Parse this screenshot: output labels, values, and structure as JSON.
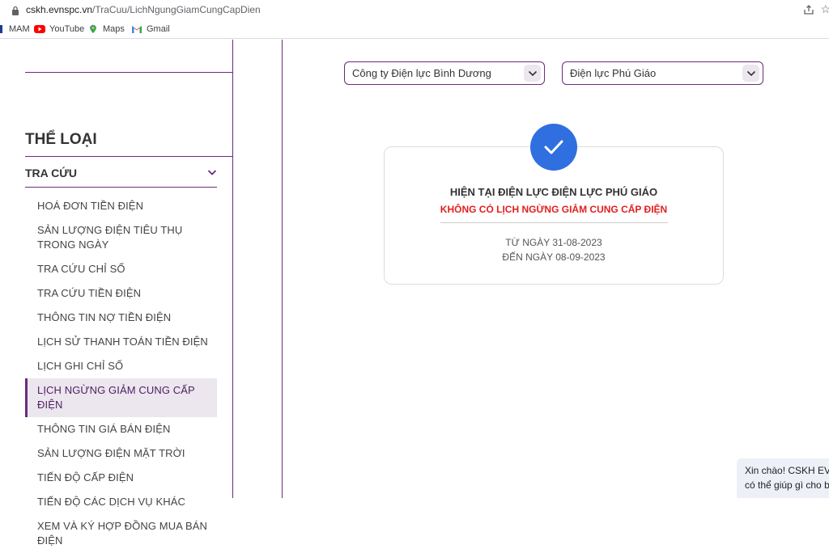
{
  "browser": {
    "url_host": "cskh.evnspc.vn",
    "url_path": "/TraCuu/LichNgungGiamCungCapDien",
    "bookmarks": [
      {
        "label": "MAM",
        "icon": "mam-icon"
      },
      {
        "label": "YouTube",
        "icon": "youtube-icon"
      },
      {
        "label": "Maps",
        "icon": "maps-icon"
      },
      {
        "label": "Gmail",
        "icon": "gmail-icon"
      }
    ]
  },
  "sidebar": {
    "category_title": "THỂ LOẠI",
    "section_title": "TRA CỨU",
    "items": [
      {
        "label": "HOÁ ĐƠN TIỀN ĐIỆN"
      },
      {
        "label": "SẢN LƯỢNG ĐIỆN TIÊU THỤ TRONG NGÀY"
      },
      {
        "label": "TRA CỨU CHỈ SỐ"
      },
      {
        "label": "TRA CỨU TIỀN ĐIỆN"
      },
      {
        "label": "THÔNG TIN NỢ TIỀN ĐIỆN"
      },
      {
        "label": "LỊCH SỬ THANH TOÁN TIỀN ĐIỆN"
      },
      {
        "label": "LỊCH GHI CHỈ SỐ"
      },
      {
        "label": "LỊCH NGỪNG GIẢM CUNG CẤP ĐIỆN",
        "active": true
      },
      {
        "label": "THÔNG TIN GIÁ BÁN ĐIỆN"
      },
      {
        "label": "SẢN LƯỢNG ĐIỆN MẶT TRỜI"
      },
      {
        "label": "TIẾN ĐỘ CẤP ĐIỆN"
      },
      {
        "label": "TIẾN ĐỘ CÁC DỊCH VỤ KHÁC"
      },
      {
        "label": "XEM VÀ KÝ HỢP ĐỒNG MUA BÁN ĐIỆN"
      }
    ]
  },
  "filters": {
    "company": "Công ty Điện lực Bình Dương",
    "branch": "Điện lực Phú Giáo"
  },
  "result": {
    "heading": "HIỆN TẠI ĐIỆN LỰC ĐIỆN LỰC PHÚ GIÁO",
    "status": "KHÔNG CÓ LỊCH NGỪNG GIẢM CUNG CẤP ĐIỆN",
    "from_date": "TỪ NGÀY 31-08-2023",
    "to_date": "ĐẾN NGÀY 08-09-2023"
  },
  "chat": {
    "line1": "Xin chào! CSKH EV",
    "line2": "có thể giúp gì cho b"
  },
  "colors": {
    "accent": "#6a2b7c",
    "check": "#2f6fe0",
    "alert": "#e41e1e"
  }
}
